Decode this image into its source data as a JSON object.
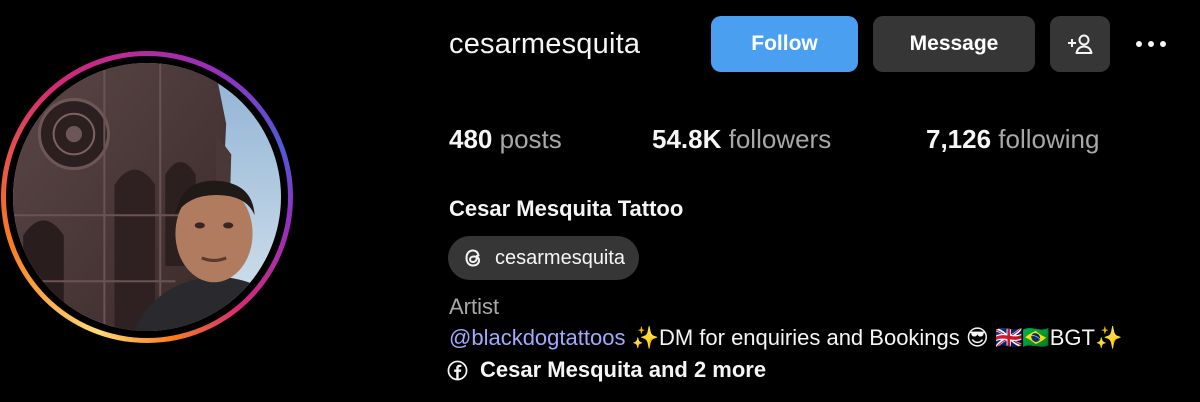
{
  "profile": {
    "username": "cesarmesquita",
    "full_name": "Cesar Mesquita Tattoo",
    "category": "Artist"
  },
  "actions": {
    "follow_label": "Follow",
    "message_label": "Message"
  },
  "stats": {
    "posts_count": "480",
    "posts_label": " posts",
    "followers_count": "54.8K",
    "followers_label": " followers",
    "following_count": "7,126",
    "following_label": " following"
  },
  "threads": {
    "handle": "cesarmesquita"
  },
  "bio": {
    "mention": "@blackdogtattoos",
    "text": " ✨DM for enquiries and Bookings 😎 🇬🇧🇧🇷BGT✨"
  },
  "links": {
    "text": "Cesar Mesquita and 2 more"
  },
  "colors": {
    "follow_button": "#4a9ff0",
    "secondary_button": "#363636",
    "mention_link": "#a3a8ff",
    "muted_text": "#a8a8a8",
    "background": "#000000"
  },
  "icons": {
    "suggest": "person-add-icon",
    "more": "more-options-icon",
    "threads": "threads-icon",
    "facebook": "facebook-icon"
  }
}
